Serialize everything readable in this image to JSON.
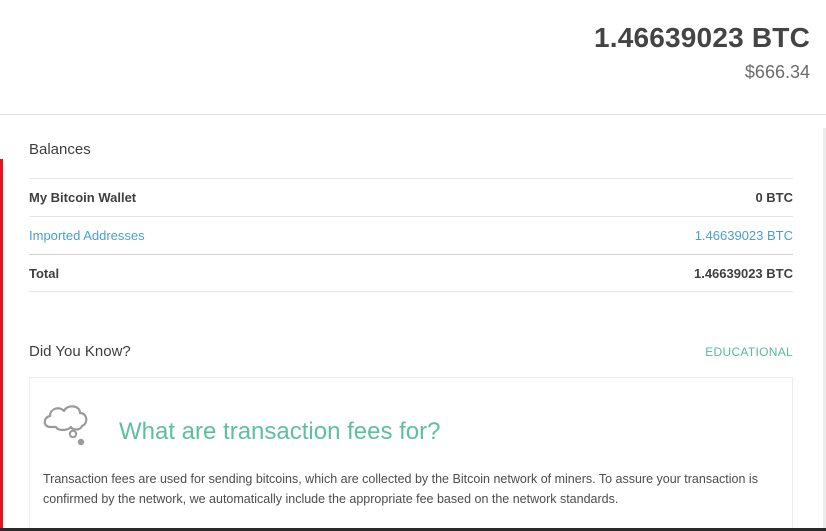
{
  "header": {
    "total_btc": "1.46639023 BTC",
    "total_usd": "$666.34"
  },
  "balances": {
    "title": "Balances",
    "rows": [
      {
        "label": "My Bitcoin Wallet",
        "value": "0 BTC"
      },
      {
        "label": "Imported Addresses",
        "value": "1.46639023 BTC"
      },
      {
        "label": "Total",
        "value": "1.46639023 BTC"
      }
    ]
  },
  "did_you_know": {
    "title": "Did You Know?",
    "category_link": "EDUCATIONAL",
    "card": {
      "icon": "thought-cloud-icon",
      "title": "What are transaction fees for?",
      "text": "Transaction fees are used for sending bitcoins, which are collected by the Bitcoin network of miners. To assure your transaction is confirmed by the network, we automatically include the appropriate fee based on the network standards."
    }
  },
  "colors": {
    "accent_red": "#e4141c",
    "link_blue": "#4a9fd0",
    "teal": "#5dbfa2"
  }
}
